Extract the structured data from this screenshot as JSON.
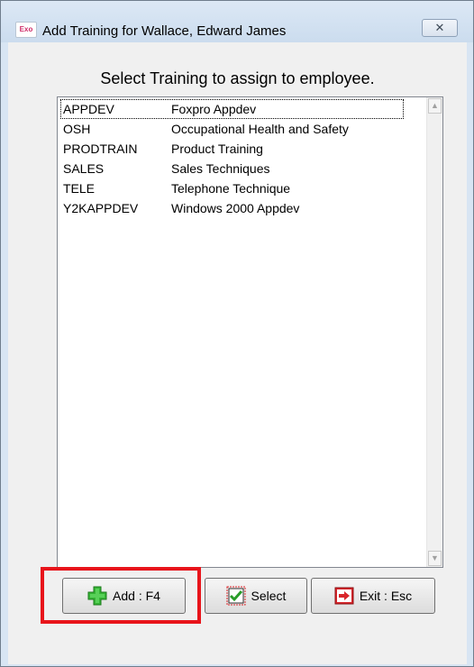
{
  "window": {
    "title": "Add Training for Wallace, Edward James",
    "app_icon_text": "Exo",
    "close_symbol": "✕"
  },
  "prompt": "Select Training to assign to employee.",
  "list": {
    "items": [
      {
        "code": "APPDEV",
        "description": "Foxpro Appdev",
        "selected": true
      },
      {
        "code": "OSH",
        "description": "Occupational Health and Safety",
        "selected": false
      },
      {
        "code": "PRODTRAIN",
        "description": "Product Training",
        "selected": false
      },
      {
        "code": "SALES",
        "description": "Sales Techniques",
        "selected": false
      },
      {
        "code": "TELE",
        "description": "Telephone Technique",
        "selected": false
      },
      {
        "code": "Y2KAPPDEV",
        "description": "Windows 2000 Appdev",
        "selected": false
      }
    ]
  },
  "buttons": {
    "add": {
      "label": "Add : F4",
      "icon": "green-plus-icon",
      "color": "#2fb52f"
    },
    "select": {
      "label": "Select",
      "icon": "green-check-icon",
      "color": "#2a9d2a"
    },
    "exit": {
      "label": "Exit : Esc",
      "icon": "red-exit-arrow-icon",
      "color": "#d9252a"
    }
  },
  "highlight_color": "#e8141b"
}
